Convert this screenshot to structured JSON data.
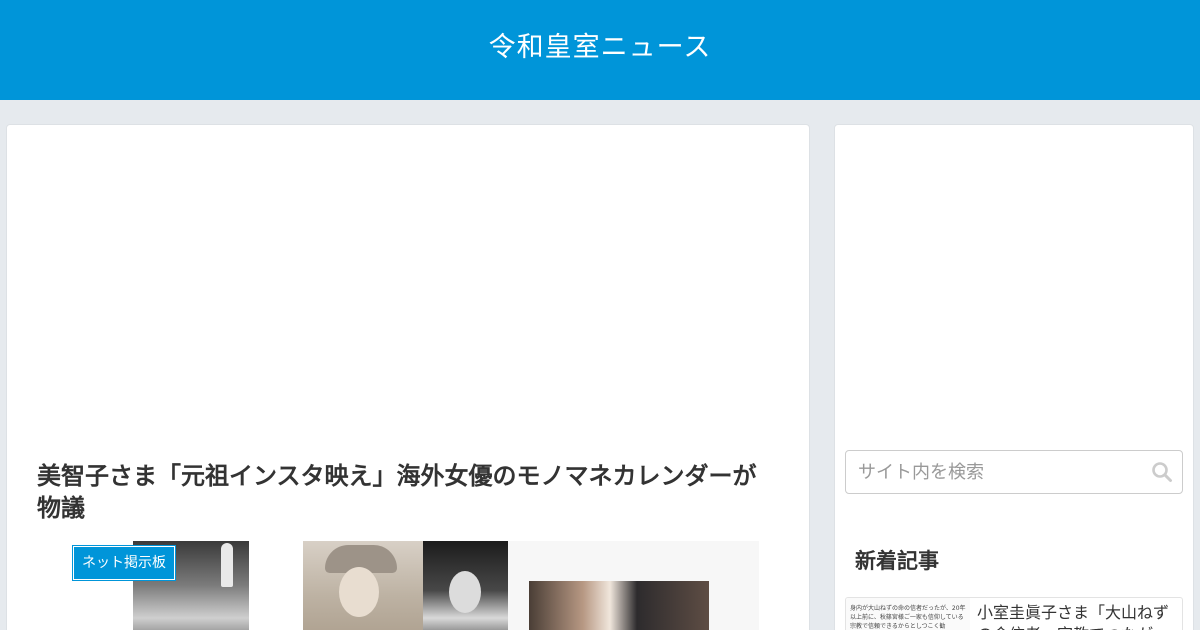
{
  "header": {
    "site_title": "令和皇室ニュース"
  },
  "article": {
    "title": "美智子さま「元祖インスタ映え」海外女優のモノマネカレンダーが物議",
    "category": "ネット掲示板"
  },
  "sidebar": {
    "search": {
      "placeholder": "サイト内を検索",
      "icon": "search-icon"
    },
    "new_entries": {
      "heading": "新着記事",
      "items": [
        {
          "title": "小室圭眞子さま「大山ねずの命信者…宗教でつなが",
          "thumb_text": "身内が大山ねずの命の信者だったが、20年以上前に、秋篠宮様ご一家も信仰している宗教で信頼できるからとしつこく勧"
        }
      ]
    }
  }
}
